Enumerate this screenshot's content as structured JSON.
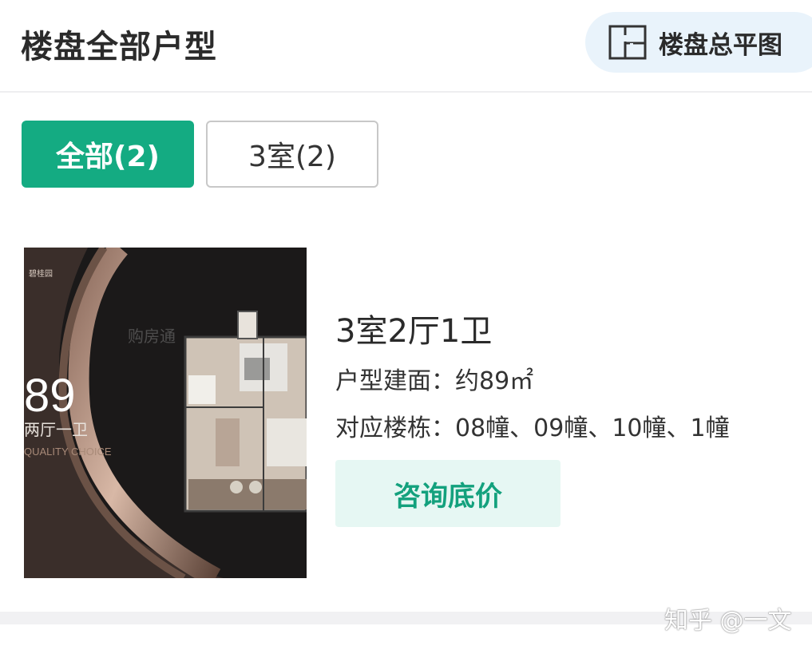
{
  "header": {
    "title": "楼盘全部户型",
    "floorplan_button": {
      "label": "楼盘总平图",
      "icon": "floor-plan-icon"
    }
  },
  "tabs": [
    {
      "label": "全部(2)",
      "active": true
    },
    {
      "label": "3室(2)",
      "active": false
    }
  ],
  "unit": {
    "image_text": {
      "brand": "碧桂园",
      "area_number": "89",
      "rooms_text": "两厅一卫",
      "english": "QUALITY CHOICE",
      "watermark": "购房通"
    },
    "title": "3室2厅1卫",
    "area": "户型建面：约89㎡",
    "buildings": "对应楼栋：08幢、09幢、10幢、1幢",
    "consult_button": "咨询底价"
  },
  "watermark": "知乎 @一文",
  "colors": {
    "accent": "#14ab82",
    "button_bg": "#e6f7f3",
    "pill_bg": "#e9f3fb"
  }
}
